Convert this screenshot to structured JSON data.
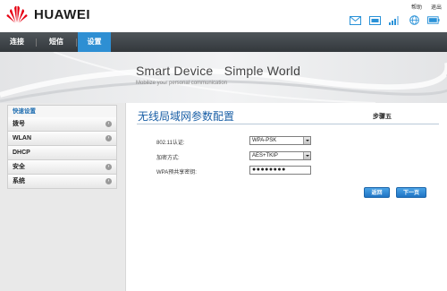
{
  "header": {
    "brand": "HUAWEI",
    "links": {
      "help": "帮助",
      "logout": "退出"
    },
    "status_icons": [
      "message-icon",
      "sms-icon",
      "signal-icon",
      "network-globe-icon",
      "battery-icon"
    ]
  },
  "nav": {
    "tabs": [
      {
        "label": "连接"
      },
      {
        "label": "短信"
      },
      {
        "label": "设置"
      }
    ],
    "active_tab": "设置"
  },
  "banner": {
    "title": "Smart Device   Simple World",
    "subtitle": "Mobilize your personal communication"
  },
  "sidebar": {
    "header": "快速设置",
    "items": [
      {
        "label": "拨号"
      },
      {
        "label": "WLAN"
      },
      {
        "label": "DHCP"
      },
      {
        "label": "安全"
      },
      {
        "label": "系统"
      }
    ]
  },
  "main": {
    "title": "无线局域网参数配置",
    "step": "步骤五",
    "fields": {
      "auth": {
        "label": "802.11认证:",
        "value": "WPA-PSK"
      },
      "encryption": {
        "label": "加密方式:",
        "value": "AES+TKIP"
      },
      "psk": {
        "label": "WPA预共享密钥:",
        "value": "●●●●●●●●"
      }
    },
    "buttons": {
      "back": "返回",
      "next": "下一页"
    }
  },
  "colors": {
    "nav_bg": "#3b4146",
    "nav_active": "#2e8fd3",
    "title_blue": "#1a5fa6",
    "button_blue": "#2b86d6",
    "huawei_red": "#e60012"
  }
}
